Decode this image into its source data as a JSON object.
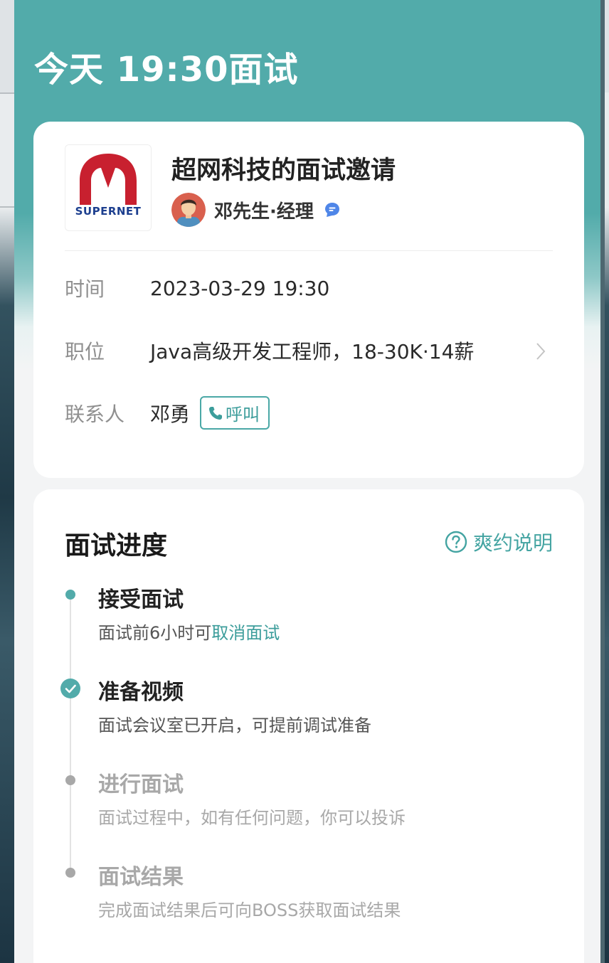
{
  "header": {
    "title": "今天 19:30面试"
  },
  "invite": {
    "company_logo_text": "SUPERNET",
    "title": "超网科技的面试邀请",
    "recruiter": "邓先生·经理",
    "rows": {
      "time_label": "时间",
      "time_value": "2023-03-29 19:30",
      "position_label": "职位",
      "position_value": "Java高级开发工程师，18-30K·14薪",
      "contact_label": "联系人",
      "contact_value": "邓勇",
      "call_label": "呼叫"
    }
  },
  "progress": {
    "title": "面试进度",
    "policy_link": "爽约说明",
    "steps": [
      {
        "title": "接受面试",
        "desc_prefix": "面试前6小时可",
        "desc_link": "取消面试",
        "state": "active"
      },
      {
        "title": "准备视频",
        "desc": "面试会议室已开启，可提前调试准备",
        "state": "done"
      },
      {
        "title": "进行面试",
        "desc": "面试过程中，如有任何问题，你可以投诉",
        "state": "pending"
      },
      {
        "title": "面试结果",
        "desc": "完成面试结果后可向BOSS获取面试结果",
        "state": "pending"
      }
    ]
  },
  "colors": {
    "accent": "#52abaa",
    "link": "#3c9d9b",
    "logo_red": "#c8202f",
    "logo_blue": "#1d3f8f",
    "muted": "#a8a8a8"
  }
}
